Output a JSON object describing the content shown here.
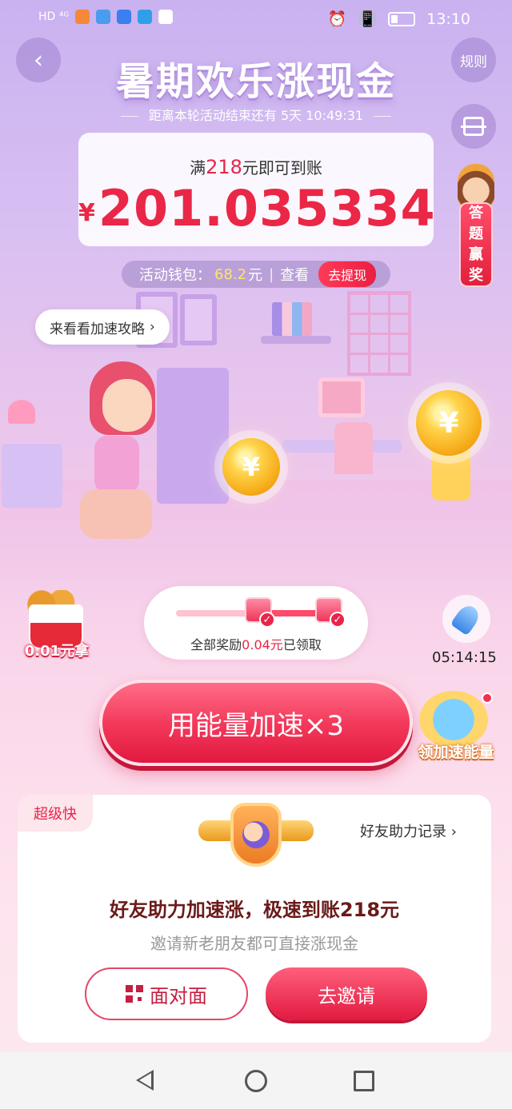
{
  "status_bar": {
    "left_indicators": "HD ⁴ᴳ",
    "time": "13:10"
  },
  "header": {
    "title": "暑期欢乐涨现金",
    "countdown_prefix": "距离本轮活动结束还有",
    "countdown_value": "5天 10:49:31",
    "rules_label": "规则"
  },
  "balance": {
    "threshold_prefix": "满",
    "threshold_amount": "218",
    "threshold_suffix": "元即可到账",
    "currency": "¥",
    "amount": "201.035334"
  },
  "quiz_badge": {
    "label_line1": "答",
    "label_line2": "题",
    "label_line3": "赢",
    "label_line4": "奖"
  },
  "wallet": {
    "label": "活动钱包：",
    "value": "68.2",
    "unit": "元",
    "view_label": "查看",
    "withdraw_label": "去提现"
  },
  "scene": {
    "tip_label": "来看看加速攻略",
    "coin_symbol": "¥"
  },
  "progress": {
    "text_prefix": "全部奖励",
    "reward_amount": "0.04元",
    "text_suffix": "已领取"
  },
  "kfc_promo": {
    "label": "0.01元拿"
  },
  "rocket": {
    "timer": "05:14:15"
  },
  "accelerate_button": {
    "label": "用能量加速×3"
  },
  "energy": {
    "label": "领加速能量"
  },
  "friend_section": {
    "tag": "超级快",
    "record_link": "好友助力记录",
    "title": "好友助力加速涨，极速到账218元",
    "subtitle": "邀请新老朋友都可直接涨现金",
    "face_to_face_label": "面对面",
    "invite_label": "去邀请"
  },
  "colors": {
    "accent_red": "#e8254a",
    "wallet_value": "#ffe36b",
    "card_title": "#6b1a1a"
  }
}
